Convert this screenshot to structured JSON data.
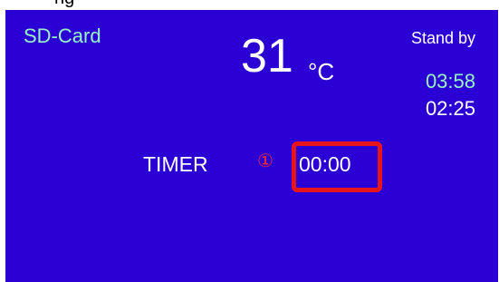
{
  "header": {
    "partial_text": "ng"
  },
  "screen": {
    "source_label": "SD-Card",
    "temperature": {
      "value": "31",
      "unit": "°C"
    },
    "status": "Stand by",
    "times": {
      "first": "03:58",
      "second": "02:25"
    },
    "timer": {
      "label": "TIMER",
      "marker": "①",
      "value": "00:00"
    }
  },
  "colors": {
    "background": "#2a00d4",
    "accent_green": "#9bf2c4",
    "highlight_red": "#e8141c",
    "text_white": "#ffffff"
  }
}
